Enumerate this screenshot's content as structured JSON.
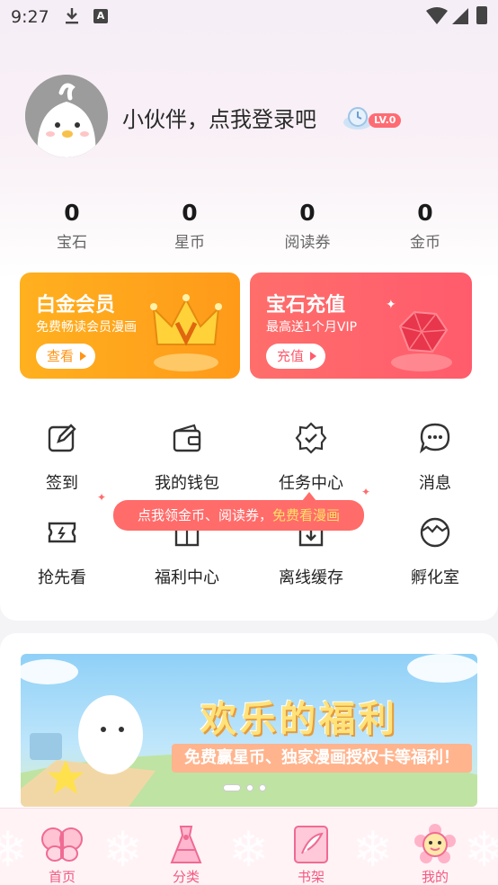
{
  "status_bar": {
    "time": "9:27",
    "letter_icon": "A"
  },
  "profile": {
    "username": "小伙伴，点我登录吧",
    "level": "LV.0"
  },
  "stats": [
    {
      "value": "0",
      "label": "宝石"
    },
    {
      "value": "0",
      "label": "星币"
    },
    {
      "value": "0",
      "label": "阅读券"
    },
    {
      "value": "0",
      "label": "金币"
    }
  ],
  "cards": {
    "vip": {
      "title": "白金会员",
      "subtitle": "免费畅读会员漫画",
      "button": "查看"
    },
    "gem": {
      "title": "宝石充值",
      "subtitle": "最高送1个月VIP",
      "button": "充值"
    }
  },
  "grid": [
    {
      "label": "签到",
      "icon": "edit-icon"
    },
    {
      "label": "我的钱包",
      "icon": "wallet-icon"
    },
    {
      "label": "任务中心",
      "icon": "badge-check-icon"
    },
    {
      "label": "消息",
      "icon": "chat-icon"
    },
    {
      "label": "抢先看",
      "icon": "ticket-icon"
    },
    {
      "label": "福利中心",
      "icon": "gift-icon"
    },
    {
      "label": "离线缓存",
      "icon": "download-icon"
    },
    {
      "label": "孵化室",
      "icon": "egg-icon"
    }
  ],
  "tooltip": {
    "text": "点我领金币、阅读券，",
    "highlight": "免费看漫画"
  },
  "banner": {
    "title": "欢乐的福利",
    "subtitle": "免费赢星币、独家漫画授权卡等福利！",
    "page_index": 1,
    "page_count": 3
  },
  "bottom_nav": [
    {
      "label": "首页",
      "icon": "butterfly-icon"
    },
    {
      "label": "分类",
      "icon": "dress-icon"
    },
    {
      "label": "书架",
      "icon": "book-icon"
    },
    {
      "label": "我的",
      "icon": "flower-face-icon"
    }
  ],
  "colors": {
    "accent": "#ff6c6a",
    "vip_card": "#ffa61c",
    "gem_card": "#ff626c",
    "nav_label": "#f15a80"
  }
}
